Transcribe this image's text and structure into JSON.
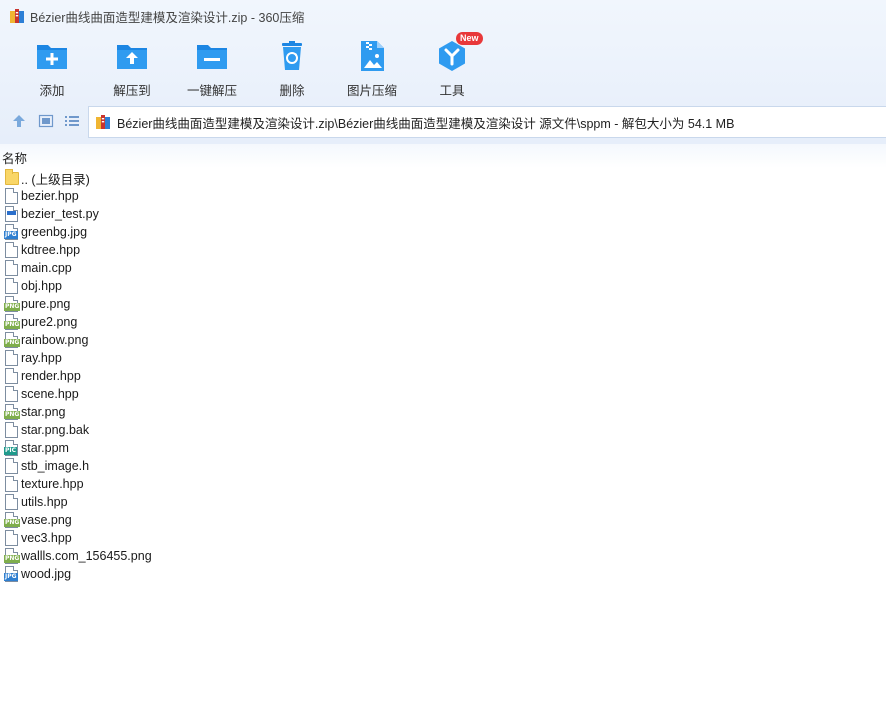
{
  "window": {
    "title": "Bézier曲线曲面造型建模及渲染设计.zip - 360压缩"
  },
  "toolbar": {
    "items": [
      {
        "label": "添加",
        "icon": "add-folder-icon"
      },
      {
        "label": "解压到",
        "icon": "extract-to-icon"
      },
      {
        "label": "一键解压",
        "icon": "one-click-extract-icon"
      },
      {
        "label": "删除",
        "icon": "recycle-bin-icon"
      },
      {
        "label": "图片压缩",
        "icon": "image-compress-icon"
      },
      {
        "label": "工具",
        "icon": "tools-icon",
        "badge": "New"
      }
    ]
  },
  "addressbar": {
    "path": "Bézier曲线曲面造型建模及渲染设计.zip\\Bézier曲线曲面造型建模及渲染设计 源文件\\sppm - 解包大小为 54.1 MB"
  },
  "list": {
    "column_name": "名称",
    "files": [
      {
        "name": ".. (上级目录)",
        "type": "folder"
      },
      {
        "name": "bezier.hpp",
        "type": "doc"
      },
      {
        "name": "bezier_test.py",
        "type": "py"
      },
      {
        "name": "greenbg.jpg",
        "type": "jpg"
      },
      {
        "name": "kdtree.hpp",
        "type": "doc"
      },
      {
        "name": "main.cpp",
        "type": "doc"
      },
      {
        "name": "obj.hpp",
        "type": "doc"
      },
      {
        "name": "pure.png",
        "type": "png"
      },
      {
        "name": "pure2.png",
        "type": "png"
      },
      {
        "name": "rainbow.png",
        "type": "png"
      },
      {
        "name": "ray.hpp",
        "type": "doc"
      },
      {
        "name": "render.hpp",
        "type": "doc"
      },
      {
        "name": "scene.hpp",
        "type": "doc"
      },
      {
        "name": "star.png",
        "type": "png"
      },
      {
        "name": "star.png.bak",
        "type": "doc"
      },
      {
        "name": "star.ppm",
        "type": "pic"
      },
      {
        "name": "stb_image.h",
        "type": "doc"
      },
      {
        "name": "texture.hpp",
        "type": "doc"
      },
      {
        "name": "utils.hpp",
        "type": "doc"
      },
      {
        "name": "vase.png",
        "type": "png"
      },
      {
        "name": "vec3.hpp",
        "type": "doc"
      },
      {
        "name": "wallls.com_156455.png",
        "type": "png"
      },
      {
        "name": "wood.jpg",
        "type": "jpg"
      }
    ]
  },
  "colors": {
    "accent": "#1d8be8",
    "badge": "#e8383a",
    "jpg_tag": "#2f7fd0",
    "png_tag": "#7fae4c",
    "pic_tag": "#1f9a8c"
  }
}
